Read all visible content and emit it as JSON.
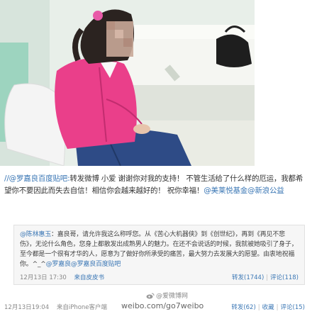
{
  "post": {
    "mention": "//@罗嘉良百度贴吧:",
    "text": "转发微博 小爱 谢谢你对我的支持！ 不管生活给了什么样的厄运，我都希望你不要因此而失去自信！相信你会越来越好的！ 祝你幸福！",
    "tag_mention": "@美莱悦基金@新浪公益"
  },
  "repost": {
    "author": "@陈林惠玉",
    "text": "：嘉良哥，请允许我这么称呼您。从《苦心大机器侠》到《创世纪》，再到《再见不悲伤》，无论什么角色，您身上都散发出成熟男人的魅力。在还不会说话的时候，我就被她吸引了身子，至今都是一个很有才华的人，愿意为了做好你所承受的痛苦，最大努力去发展大的愿望。由衷地祝福你。^_^",
    "tail_mention": "@罗嘉良@罗嘉良百度贴吧",
    "time": "12月13日 17:30",
    "source": "来自皮皮书",
    "forward": "转发(1744)",
    "comment": "评论(118)"
  },
  "watermark": {
    "brand": "@爱微博网",
    "url": "weibo.com/go7weibo"
  },
  "footer": {
    "time": "12月13日19:04",
    "source": "来自iPhone客户端",
    "forward": "转发(62)",
    "favorite": "收藏",
    "comment": "评论(15)"
  }
}
